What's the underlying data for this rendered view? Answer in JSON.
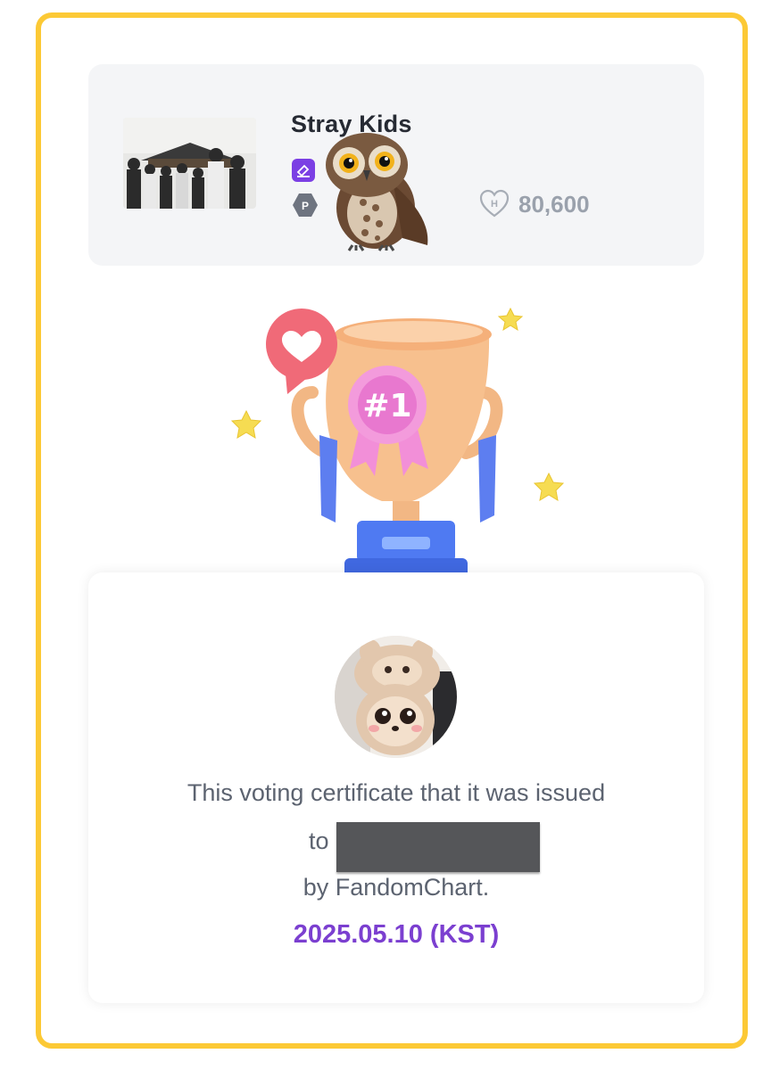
{
  "artist": {
    "name": "Stray Kids",
    "badge_letter": "P",
    "points": "80,600"
  },
  "certificate": {
    "line1": "This voting certificate that it was issued",
    "line2": "to",
    "line3": "by FandomChart.",
    "date": "2025.05.10 (KST)"
  },
  "trophy": {
    "ribbon_text": "#1"
  },
  "colors": {
    "frame": "#fcc935",
    "accent_purple": "#7b3fd0",
    "card_bg": "#f4f5f7",
    "muted_text": "#9aa1ac"
  },
  "icons": [
    "artist-photo",
    "edit-badge-icon",
    "p-grade-hex-icon",
    "owl-sticker",
    "heart-h-icon",
    "trophy-illustration",
    "heart-bubble-icon",
    "star-icon",
    "avatar-plush"
  ]
}
